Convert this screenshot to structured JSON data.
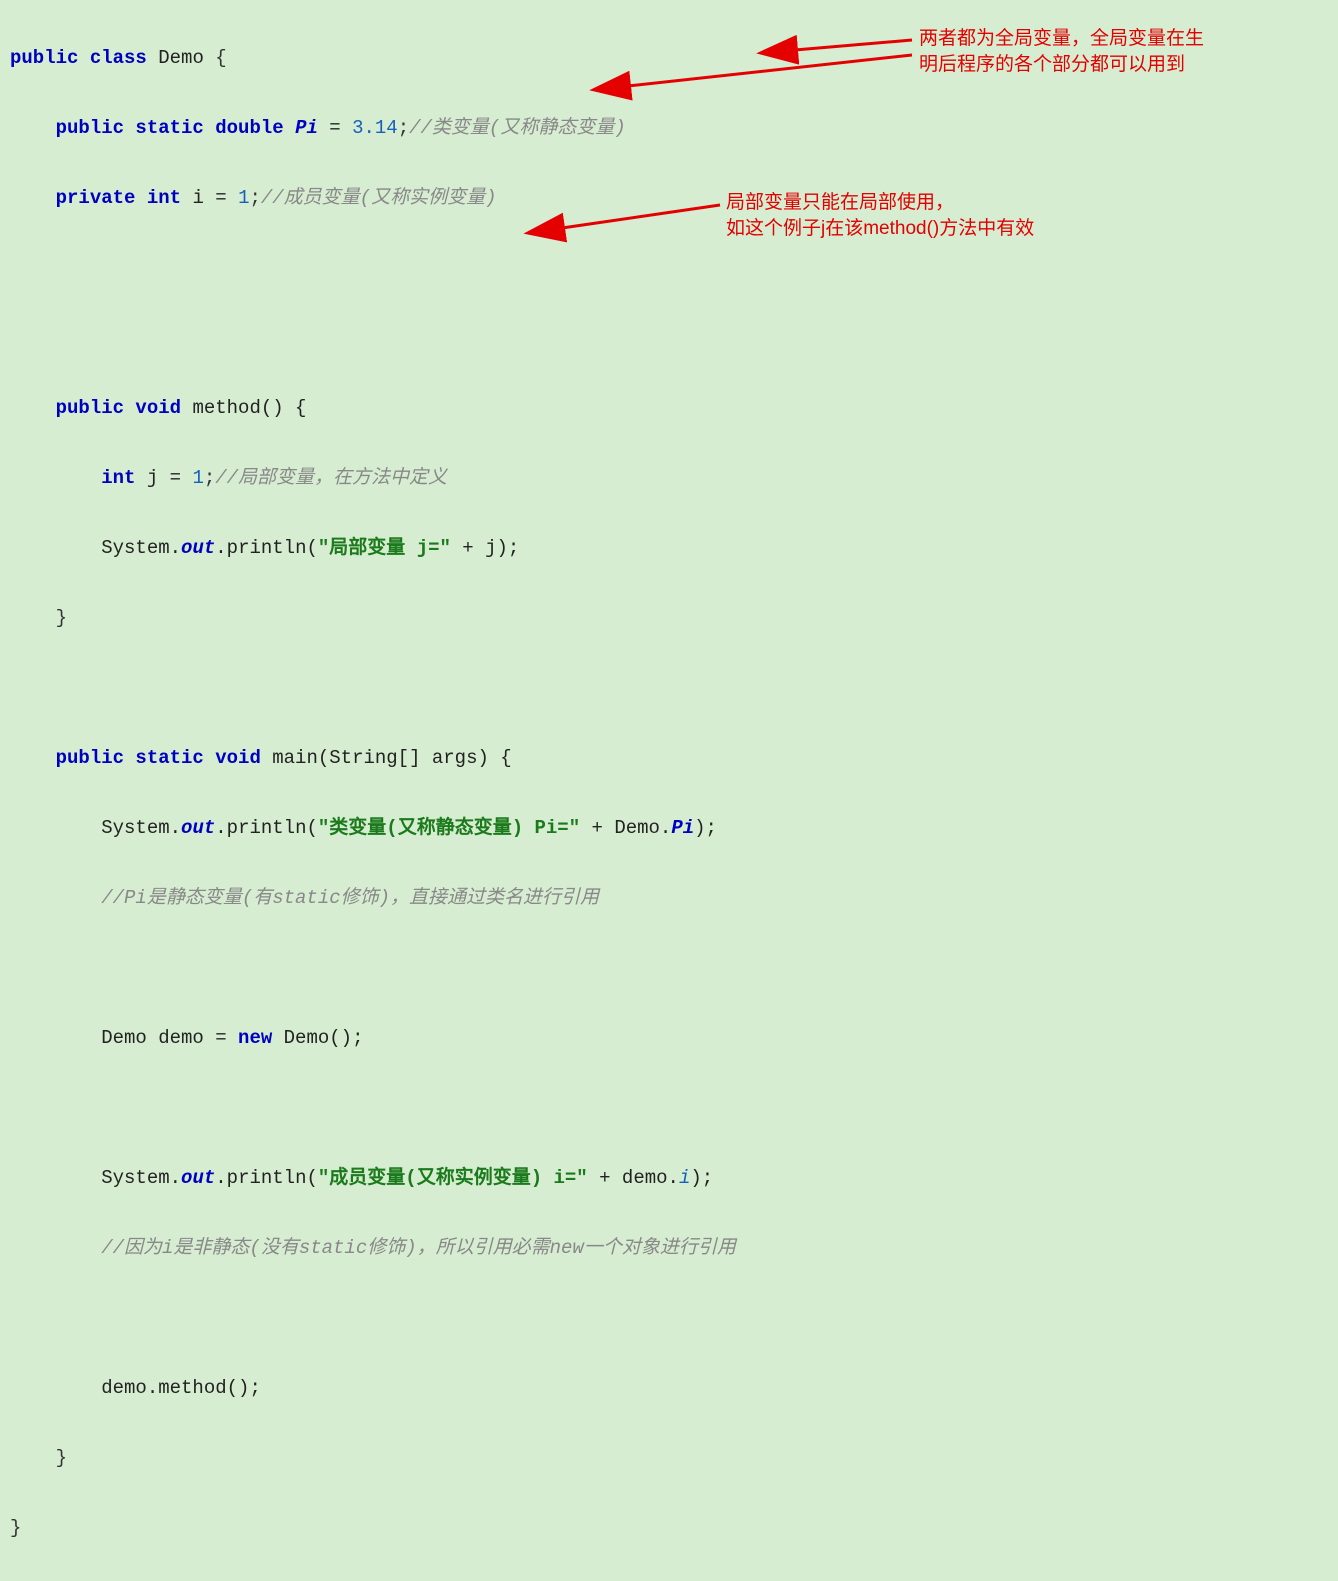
{
  "annotations": {
    "a1_line1": "两者都为全局变量，全局变量在生",
    "a1_line2": "明后程序的各个部分都可以用到",
    "a2_line1": "局部变量只能在局部使用，",
    "a2_line2": "如这个例子j在该method()方法中有效"
  },
  "code": {
    "l1_kw1": "public class ",
    "l1_cls": "Demo ",
    "l1_brace": "{",
    "l2_indent": "    ",
    "l2_kw": "public static double ",
    "l2_pi": "Pi",
    "l2_eq": " = ",
    "l2_num": "3.14",
    "l2_semi": ";",
    "l2_cmt": "//类变量(又称静态变量)",
    "l3_indent": "    ",
    "l3_kw": "private int ",
    "l3_i": "i ",
    "l3_eq": "= ",
    "l3_num": "1",
    "l3_semi": ";",
    "l3_cmt": "//成员变量(又称实例变量)",
    "l6_indent": "    ",
    "l6_kw": "public void ",
    "l6_name": "method() {",
    "l7_indent": "        ",
    "l7_kw": "int ",
    "l7_j": "j = ",
    "l7_num": "1",
    "l7_semi": ";",
    "l7_cmt": "//局部变量，在方法中定义",
    "l8_indent": "        ",
    "l8_sys": "System.",
    "l8_out": "out",
    "l8_p": ".println(",
    "l8_str": "\"局部变量 j=\"",
    "l8_plus": " + j);",
    "l9_indent": "    ",
    "l9_brace": "}",
    "l11_indent": "    ",
    "l11_kw": "public static void ",
    "l11_name": "main(String[] args) {",
    "l12_indent": "        ",
    "l12_sys": "System.",
    "l12_out": "out",
    "l12_p": ".println(",
    "l12_str": "\"类变量(又称静态变量) Pi=\"",
    "l12_plus": " + Demo.",
    "l12_pi": "Pi",
    "l12_end": ");",
    "l13_indent": "        ",
    "l13_cmt": "//Pi是静态变量(有static修饰)，直接通过类名进行引用",
    "l15_indent": "        ",
    "l15_a": "Demo demo = ",
    "l15_kw": "new ",
    "l15_b": "Demo();",
    "l17_indent": "        ",
    "l17_sys": "System.",
    "l17_out": "out",
    "l17_p": ".println(",
    "l17_str": "\"成员变量(又称实例变量) i=\"",
    "l17_plus": " + demo.",
    "l17_i": "i",
    "l17_end": ");",
    "l18_indent": "        ",
    "l18_cmt": "//因为i是非静态(没有static修饰)，所以引用必需new一个对象进行引用",
    "l20_indent": "        ",
    "l20_a": "demo.method();",
    "l21_indent": "    ",
    "l21_brace": "}",
    "l22_brace": "}"
  }
}
